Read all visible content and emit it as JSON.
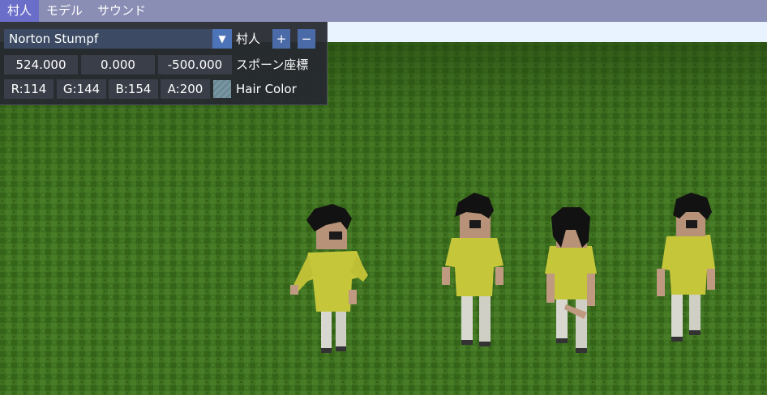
{
  "menubar": {
    "items": [
      {
        "label": "村人"
      },
      {
        "label": "モデル"
      },
      {
        "label": "サウンド"
      }
    ]
  },
  "panel": {
    "villager_combo": {
      "value": "Norton Stumpf"
    },
    "villager_label": "村人",
    "add_label": "+",
    "remove_label": "−",
    "spawn": {
      "x": "524.000",
      "y": "0.000",
      "z": "-500.000",
      "label": "スポーン座標"
    },
    "hair_color": {
      "r": "R:114",
      "g": "G:144",
      "b": "B:154",
      "a": "A:200",
      "label": "Hair Color",
      "swatch_color": "#72909a"
    }
  },
  "scene": {
    "sky_color": "#e6f2ff",
    "grass_color": "#3a6a1e",
    "shirt_color": "#c8c83a",
    "pants_color": "#d8d8d0",
    "hair_color": "#111111",
    "skin_color": "#c09a80"
  }
}
